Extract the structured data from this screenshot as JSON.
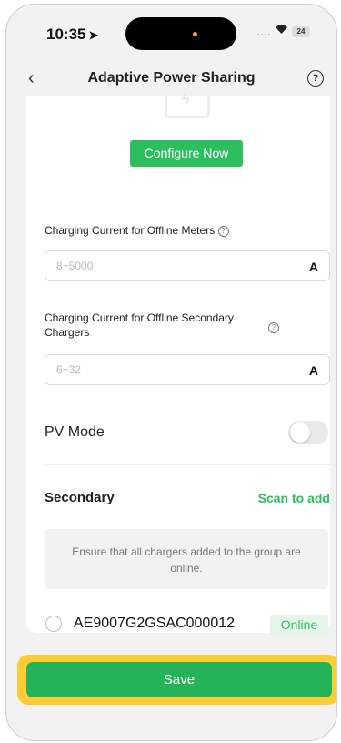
{
  "status_bar": {
    "time": "10:35",
    "signal": "....",
    "battery": "24"
  },
  "header": {
    "title": "Adaptive Power Sharing"
  },
  "configure": {
    "button_label": "Configure Now"
  },
  "offline_meters": {
    "label": "Charging Current for Offline Meters",
    "placeholder": "8~5000",
    "unit": "A"
  },
  "offline_secondary": {
    "label_line1": "Charging Current for Offline Secondary",
    "label_line2": "Chargers",
    "placeholder": "6~32",
    "unit": "A"
  },
  "pv_mode": {
    "label": "PV Mode",
    "enabled": false
  },
  "secondary": {
    "title": "Secondary",
    "scan_label": "Scan to add",
    "notice": "Ensure that all chargers added to the group are online.",
    "chargers": [
      {
        "id": "AE9007G2GSAC000012",
        "status": "Online"
      }
    ]
  },
  "footer": {
    "save_label": "Save"
  },
  "colors": {
    "accent": "#2dbe60",
    "highlight": "#ffcc33"
  }
}
